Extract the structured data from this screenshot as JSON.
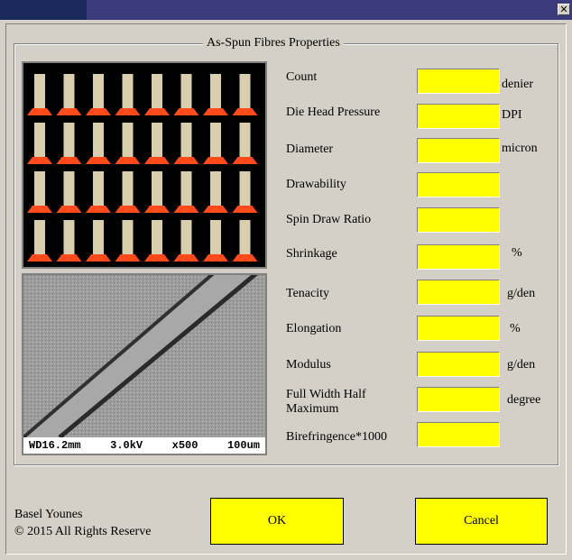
{
  "window": {
    "close_glyph": "✕",
    "accent_color": "#ffff00"
  },
  "group": {
    "title": "As-Spun Fibres Properties"
  },
  "images": {
    "spools_name": "spools-photo",
    "sem_caption": {
      "wd": "WD16.2mm",
      "kv": "3.0kV",
      "mag": "x500",
      "scale": "100um"
    }
  },
  "fields": [
    {
      "label": "Count",
      "unit": "denier",
      "value": ""
    },
    {
      "label": "Die Head Pressure",
      "unit": "DPI",
      "value": ""
    },
    {
      "label": "Diameter",
      "unit": "micron",
      "value": ""
    },
    {
      "label": "Drawability",
      "unit": "",
      "value": ""
    },
    {
      "label": "Spin Draw Ratio",
      "unit": "",
      "value": ""
    },
    {
      "label": "Shrinkage",
      "unit": "%",
      "value": ""
    },
    {
      "label": "Tenacity",
      "unit": "g/den",
      "value": ""
    },
    {
      "label": "Elongation",
      "unit": "%",
      "value": ""
    },
    {
      "label": "Modulus",
      "unit": "g/den",
      "value": ""
    },
    {
      "label": "Full Width Half Maximum",
      "unit": "degree",
      "value": ""
    },
    {
      "label": "Birefringence*1000",
      "unit": "",
      "value": ""
    }
  ],
  "footer": {
    "author": "Basel Younes",
    "copyright": "© 2015  All Rights Reserve"
  },
  "buttons": {
    "ok": "OK",
    "cancel": "Cancel"
  }
}
